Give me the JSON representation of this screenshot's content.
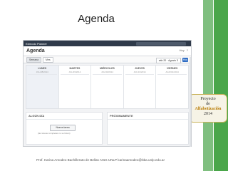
{
  "slide": {
    "title": "Agenda",
    "footer": "Prof. Karina Amodeo Bachillerato de Bellas Artes UNLP karinaamodeo@bba.unlp.edu.ar"
  },
  "logo": {
    "line1": "Proyecto",
    "line2": "de",
    "line3": "Alfabetización",
    "line4": "2014"
  },
  "app": {
    "topbar": {
      "brand": "Edmodo Planner"
    },
    "header": {
      "title": "Agenda",
      "subtitle": "",
      "right_label": "Hoy",
      "icon_label": "?"
    },
    "tabs": [
      {
        "label": "Semana"
      },
      {
        "label": "Mes"
      }
    ],
    "range": {
      "label": "sáb 20 · Agosto 3",
      "go": "Hoy"
    },
    "days": [
      {
        "name": "LUNES",
        "date": "JUL/28/2014"
      },
      {
        "name": "MARTES",
        "date": "JUL/29/2014"
      },
      {
        "name": "MIÉRCOLES",
        "date": "JUL/30/2014"
      },
      {
        "name": "JUEVES",
        "date": "JUL/31/2014"
      },
      {
        "name": "VIERNES",
        "date": "AGO/01/2014"
      }
    ],
    "panels": {
      "left": {
        "title": "ALGÚN DÍA",
        "button": "Nueva tarea",
        "hint": "(las tareas completas no se listan)"
      },
      "right": {
        "title": "PRÓXIMAMENTE"
      }
    }
  },
  "colors": {
    "accent_green_light": "#7fbf7f",
    "accent_green_dark": "#4aa64a",
    "topbar": "#2f3a4a",
    "primary_button": "#2e6cc4"
  }
}
